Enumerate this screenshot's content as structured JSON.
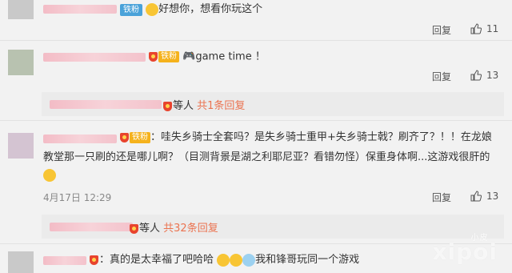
{
  "comments": [
    {
      "badge": "铁粉",
      "text": "好想你，想看你玩这个",
      "reply_label": "回复",
      "likes": "11"
    },
    {
      "badge": "铁粉",
      "text": "game time  ！",
      "reply_label": "回复",
      "likes": "13",
      "sub": {
        "others": "等人",
        "count_link": "共1条回复"
      }
    },
    {
      "badge": "铁粉",
      "text_line1": "：哇失乡骑士全套吗？是失乡骑士重甲+失乡骑士戟？刷齐了？！！在龙娘",
      "text_line2": "教堂那一只刷的还是哪儿啊？（目测背景是湖之利耶尼亚？看错勿怪）保重身体啊...这游戏很肝的",
      "timestamp": "4月17日 12:29",
      "reply_label": "回复",
      "likes": "13",
      "sub": {
        "others": "等人",
        "count_link": "共32条回复"
      }
    },
    {
      "text_a": "：真的是太幸福了吧哈哈",
      "text_b": "我和锋哥玩同一个游戏"
    }
  ],
  "watermark": {
    "main": "xipoi",
    "small": "小皮"
  },
  "colors": {
    "link": "#eb7350",
    "badge_blue": "#4aa2d9",
    "badge_gold": "#f5b21c"
  }
}
